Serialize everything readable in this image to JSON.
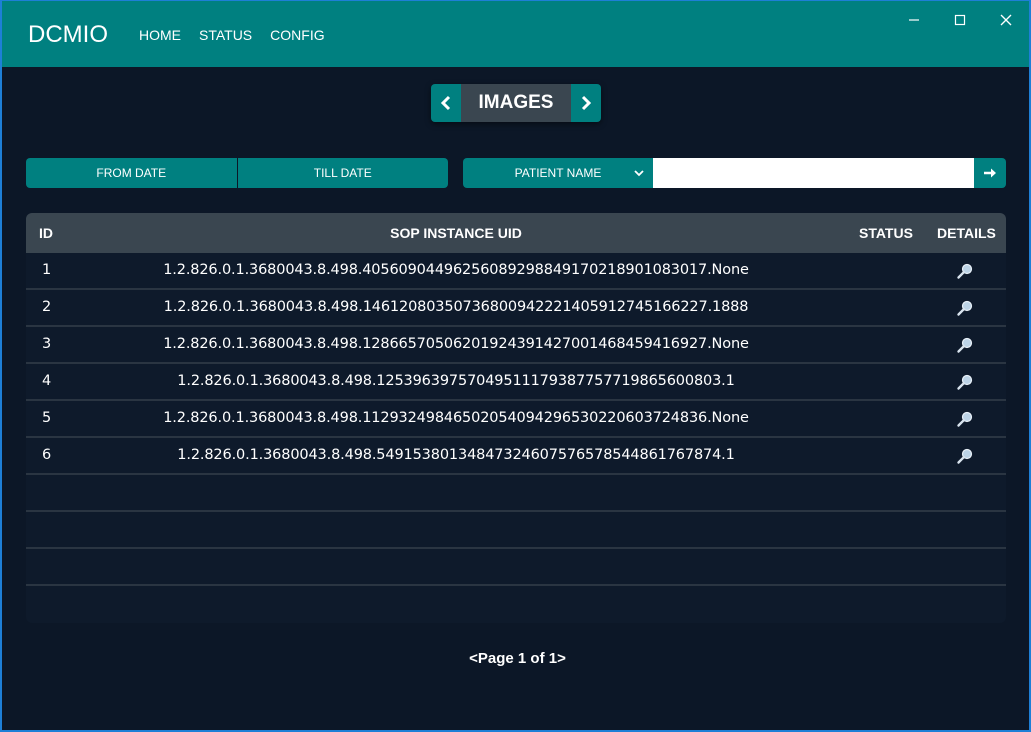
{
  "app": {
    "title": "DCMIO"
  },
  "nav": {
    "items": [
      {
        "label": "HOME"
      },
      {
        "label": "STATUS"
      },
      {
        "label": "CONFIG"
      }
    ]
  },
  "section": {
    "title": "IMAGES"
  },
  "filters": {
    "from_date_label": "FROM DATE",
    "till_date_label": "TILL DATE",
    "field_selected": "PATIENT NAME",
    "search_value": ""
  },
  "table": {
    "headers": {
      "id": "ID",
      "uid": "SOP INSTANCE UID",
      "status": "STATUS",
      "details": "DETAILS"
    },
    "rows": [
      {
        "id": "1",
        "uid": "1.2.826.0.1.3680043.8.498.40560904496256089298849170218901083017.None",
        "status": ""
      },
      {
        "id": "2",
        "uid": "1.2.826.0.1.3680043.8.498.14612080350736800942221405912745166227.1888",
        "status": ""
      },
      {
        "id": "3",
        "uid": "1.2.826.0.1.3680043.8.498.12866570506201924391427001468459416927.None",
        "status": ""
      },
      {
        "id": "4",
        "uid": "1.2.826.0.1.3680043.8.498.12539639757049511179387757719865600803.1",
        "status": ""
      },
      {
        "id": "5",
        "uid": "1.2.826.0.1.3680043.8.498.11293249846502054094296530220603724836.None",
        "status": ""
      },
      {
        "id": "6",
        "uid": "1.2.826.0.1.3680043.8.498.54915380134847324607576578544861767874.1",
        "status": ""
      }
    ]
  },
  "pagination": {
    "text": "<Page 1 of 1>"
  },
  "icons": {
    "minimize": "minimize-icon",
    "maximize": "maximize-icon",
    "close": "close-icon",
    "prev": "chevron-left-icon",
    "next": "chevron-right-icon",
    "dropdown": "chevron-down-icon",
    "go": "arrow-right-icon",
    "details": "magnifier-icon"
  },
  "colors": {
    "accent": "#008080",
    "background": "#0c1727",
    "header": "#3a4650",
    "window_border": "#1e7fd6"
  }
}
